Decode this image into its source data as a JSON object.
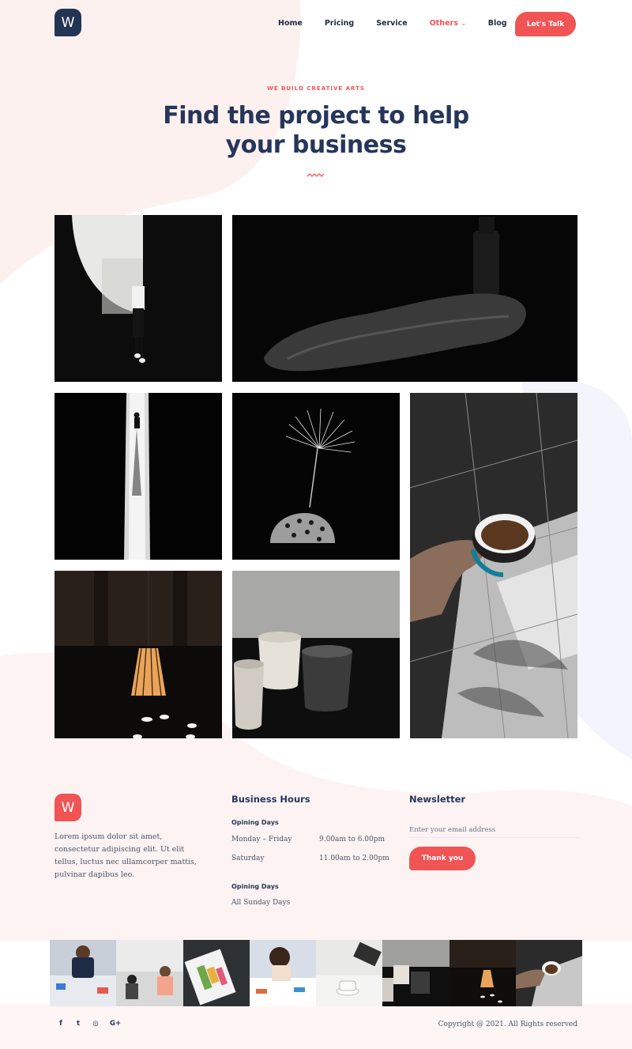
{
  "brand": {
    "logo_letter": "W",
    "accent": "#f05454",
    "navy": "#233554"
  },
  "nav": {
    "items": [
      {
        "label": "Home"
      },
      {
        "label": "Pricing"
      },
      {
        "label": "Service"
      },
      {
        "label": "Others",
        "active": true,
        "has_dropdown": true
      },
      {
        "label": "Blog"
      }
    ],
    "cta_label": "Let's Talk"
  },
  "hero": {
    "eyebrow": "WE BUILD CREATIVE ARTS",
    "title_line1": "Find the project to help",
    "title_line2": "your business"
  },
  "gallery": {
    "tiles": [
      "woman-against-white-wall",
      "black-bottle-on-rock",
      "person-walking-in-light-beam",
      "dandelion-seed-head",
      "hand-holding-espresso-cup",
      "pendant-lamp",
      "ceramic-cups"
    ]
  },
  "footer": {
    "logo_letter": "W",
    "description": "Lorem ipsum dolor sit amet, consectetur adipiscing elit. Ut elit tellus, luctus nec ullamcorper mattis, pulvinar dapibus leo.",
    "hours": {
      "heading": "Business Hours",
      "open_label": "Opining Days",
      "rows": [
        {
          "day": "Monday – Friday",
          "time": "9.00am to 6.00pm"
        },
        {
          "day": "Saturday",
          "time": "11.00am to 2.00pm"
        }
      ],
      "closed_label": "Opining Days",
      "closed_value": "All Sunday Days"
    },
    "newsletter": {
      "heading": "Newsletter",
      "placeholder": "Enter your email address",
      "button_label": "Thank you"
    },
    "social_icons": [
      {
        "name": "facebook-icon",
        "glyph": "f"
      },
      {
        "name": "twitter-icon",
        "glyph": "t"
      },
      {
        "name": "instagram-icon",
        "glyph": "◎"
      },
      {
        "name": "google-plus-icon",
        "glyph": "G+"
      }
    ],
    "copyright": "Copyright @ 2021. All Rights reserved"
  }
}
